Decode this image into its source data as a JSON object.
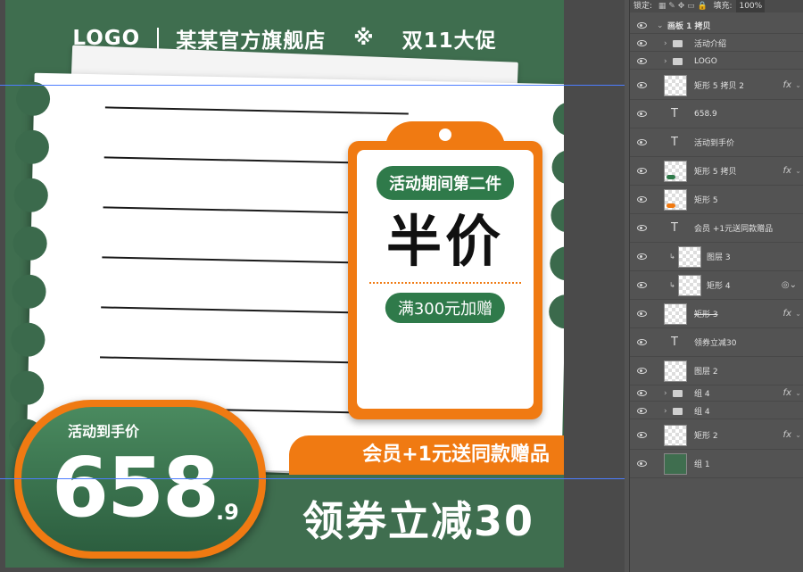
{
  "artboard": {
    "title_logo": "LOGO",
    "title_store": "某某官方旗舰店",
    "title_mark": "※",
    "title_event": "双11大促",
    "tag_promo": "活动期间第二件",
    "tag_big": "半价",
    "tag_bonus": "满300元加赠",
    "member_offer": "会员+1元送同款赠品",
    "price_label": "活动到手价",
    "price_value": "658",
    "price_decimal": ".9",
    "coupon_text": "领券立减30",
    "colors": {
      "green": "#3f6e4f",
      "orange": "#f07a12"
    }
  },
  "panel": {
    "lock_label": "锁定:",
    "fill_label": "填充:",
    "fill_value": "100%",
    "layers": [
      {
        "name": "画板 1 拷贝",
        "type": "artboard"
      },
      {
        "name": "活动介绍",
        "type": "group"
      },
      {
        "name": "LOGO",
        "type": "group"
      },
      {
        "name": "矩形 5 拷贝 2",
        "type": "shape",
        "fx": "fx"
      },
      {
        "name": "658.9",
        "type": "text"
      },
      {
        "name": "活动到手价",
        "type": "text"
      },
      {
        "name": "矩形 5 拷贝",
        "type": "shape",
        "fx": "fx"
      },
      {
        "name": "矩形 5",
        "type": "shape"
      },
      {
        "name": "会员 +1元送同款赠品",
        "type": "text"
      },
      {
        "name": "图层 3",
        "type": "layer"
      },
      {
        "name": "矩形 4",
        "type": "shape"
      },
      {
        "name": "矩形 3",
        "type": "shape",
        "fx": "fx"
      },
      {
        "name": "领券立减30",
        "type": "text"
      },
      {
        "name": "图层 2",
        "type": "layer"
      },
      {
        "name": "组 4",
        "type": "group",
        "fx": "fx"
      },
      {
        "name": "组 4",
        "type": "group"
      },
      {
        "name": "矩形 2",
        "type": "shape",
        "fx": "fx"
      },
      {
        "name": "组 1",
        "type": "layer"
      }
    ]
  }
}
